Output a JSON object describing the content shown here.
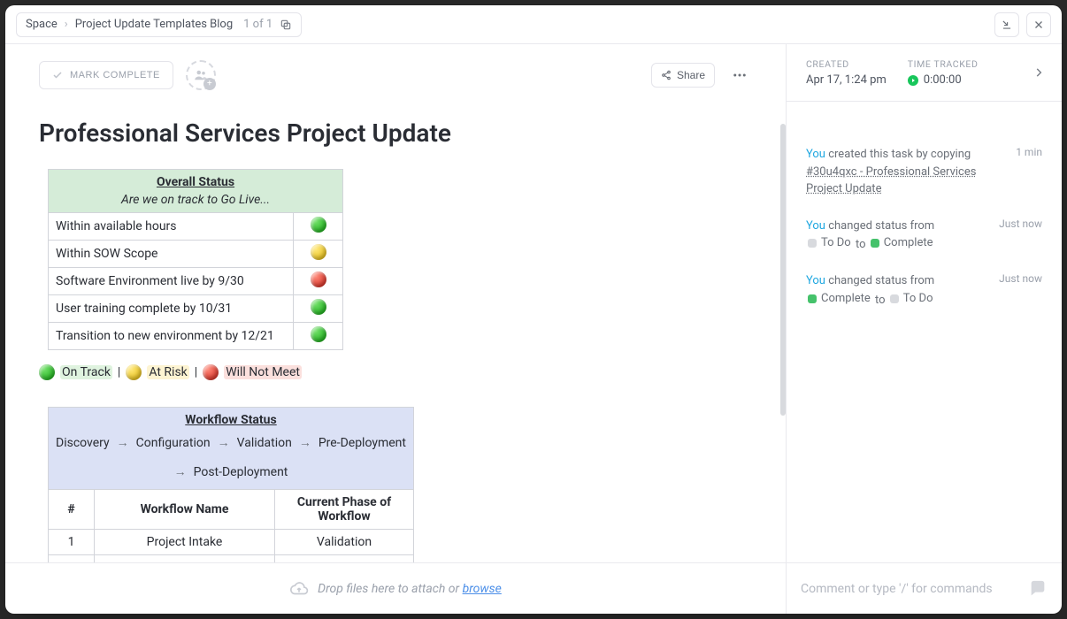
{
  "breadcrumb": {
    "root": "Space",
    "page": "Project Update Templates Blog",
    "count": "1 of 1"
  },
  "header": {
    "mark_complete": "MARK COMPLETE",
    "share": "Share"
  },
  "title": "Professional Services Project Update",
  "overall_status": {
    "title": "Overall Status",
    "subtitle": "Are we on track to Go Live...",
    "rows": [
      {
        "label": "Within available hours",
        "color": "green"
      },
      {
        "label": "Within SOW Scope",
        "color": "yellow"
      },
      {
        "label": "Software Environment live by 9/30",
        "color": "red"
      },
      {
        "label": "User training complete by 10/31",
        "color": "green"
      },
      {
        "label": "Transition to new environment by 12/21",
        "color": "green"
      }
    ]
  },
  "legend": {
    "on_track": "On Track",
    "at_risk": "At Risk",
    "will_not_meet": "Will Not Meet"
  },
  "workflow": {
    "title": "Workflow Status",
    "stages": [
      "Discovery",
      "Configuration",
      "Validation",
      "Pre-Deployment",
      "Post-Deployment"
    ],
    "columns": {
      "num": "#",
      "name": "Workflow Name",
      "phase": "Current Phase of Workflow"
    },
    "rows": [
      {
        "num": "1",
        "name": "Project Intake",
        "phase": "Validation"
      }
    ]
  },
  "sidebar": {
    "created_label": "CREATED",
    "created_value": "Apr 17, 1:24 pm",
    "time_label": "TIME TRACKED",
    "time_value": "0:00:00"
  },
  "activity": {
    "you": "You",
    "items": [
      {
        "text_before": "created this task by copying ",
        "link": "#30u4qxc - Professional Services Project Update",
        "time": "1 min"
      },
      {
        "text_before": "changed status from",
        "from_status": "To Do",
        "from_color": "grey",
        "to_status": "Complete",
        "to_color": "green",
        "time": "Just now"
      },
      {
        "text_before": "changed status from",
        "from_status": "Complete",
        "from_color": "green",
        "to_status": "To Do",
        "to_color": "grey",
        "time": "Just now"
      }
    ],
    "to_word": "to"
  },
  "footer": {
    "drop_text": "Drop files here to attach or ",
    "browse": "browse",
    "comment_placeholder": "Comment or type '/' for commands"
  }
}
